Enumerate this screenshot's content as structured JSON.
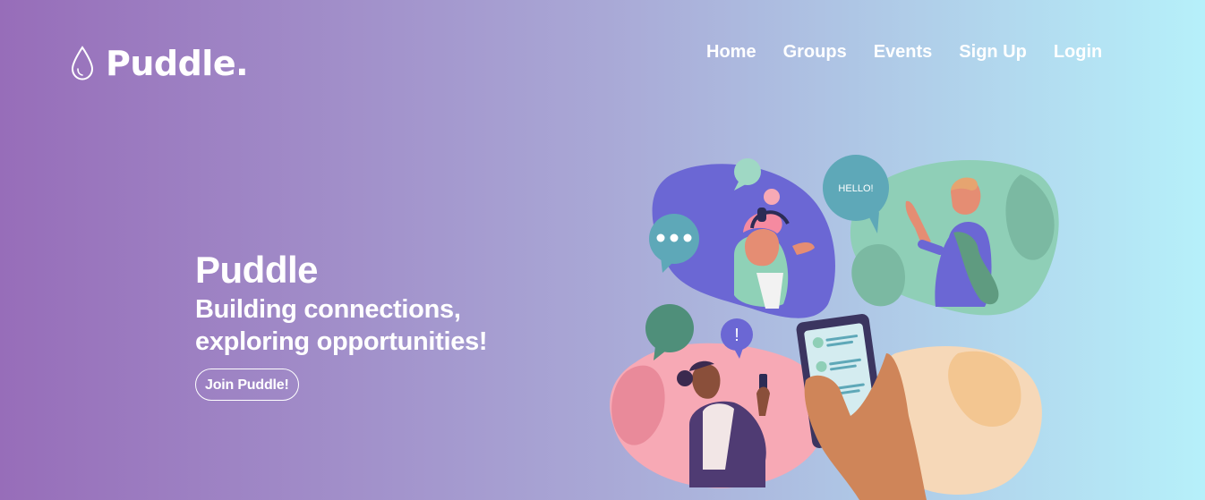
{
  "brand": {
    "name": "Puddle.",
    "icon": "water-drop-icon"
  },
  "nav": {
    "items": [
      {
        "label": "Home"
      },
      {
        "label": "Groups"
      },
      {
        "label": "Events"
      },
      {
        "label": "Sign Up"
      },
      {
        "label": "Login"
      }
    ]
  },
  "hero": {
    "title": "Puddle",
    "subtitle": "Building connections, exploring opportunities!",
    "cta_label": "Join Puddle!"
  },
  "illustration": {
    "speech_bubble_text": "HELLO!",
    "alert_bubble_text": "!"
  },
  "colors": {
    "gradient_start": "#9a6fbb",
    "gradient_end": "#b6f0fa",
    "text": "#ffffff"
  }
}
